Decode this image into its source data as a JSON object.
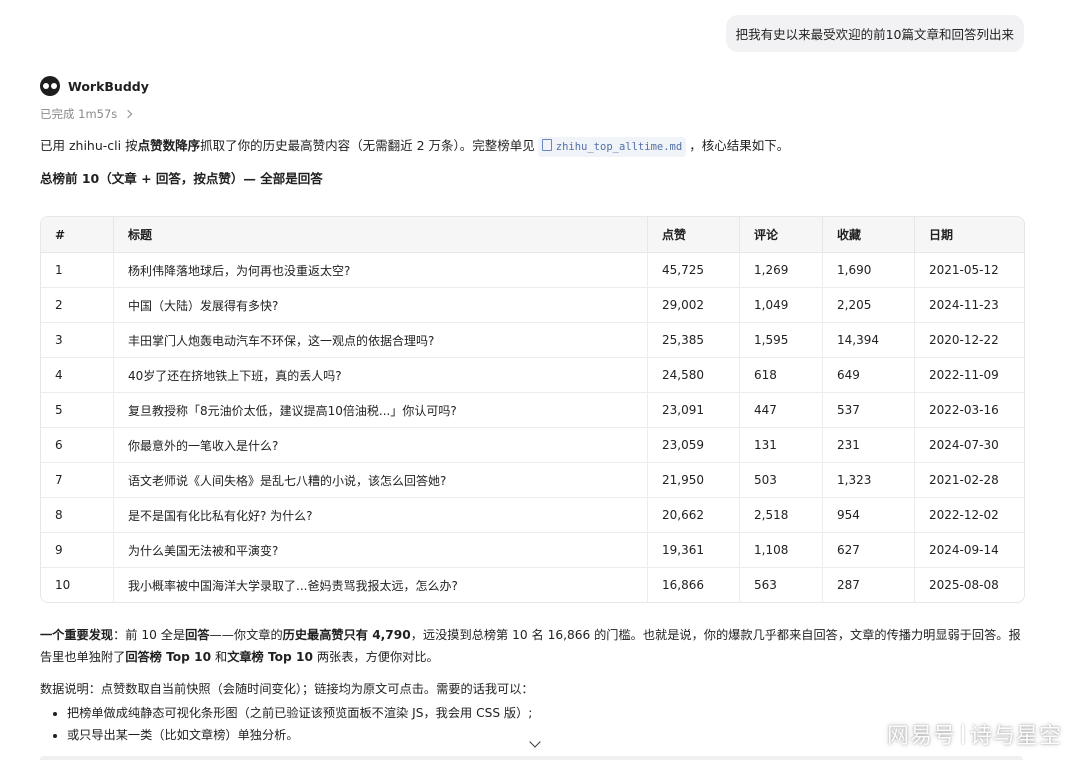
{
  "user_message": "把我有史以来最受欢迎的前10篇文章和回答列出来",
  "agent": {
    "name": "WorkBuddy",
    "status": "已完成 1m57s"
  },
  "intro": {
    "p1": "已用 zhihu-cli 按",
    "p1_bold": "点赞数降序",
    "p2": "抓取了你的历史最高赞内容（无需翻近 2 万条）。完整榜单见",
    "file_name": "zhihu_top_alltime.md",
    "p3": "，核心结果如下。"
  },
  "heading": "总榜前 10（文章 + 回答，按点赞）— 全部是回答",
  "table": {
    "headers": [
      "#",
      "标题",
      "点赞",
      "评论",
      "收藏",
      "日期"
    ],
    "rows": [
      [
        "1",
        "杨利伟降落地球后，为何再也没重返太空?",
        "45,725",
        "1,269",
        "1,690",
        "2021-05-12"
      ],
      [
        "2",
        "中国（大陆）发展得有多快?",
        "29,002",
        "1,049",
        "2,205",
        "2024-11-23"
      ],
      [
        "3",
        "丰田掌门人炮轰电动汽车不环保，这一观点的依据合理吗?",
        "25,385",
        "1,595",
        "14,394",
        "2020-12-22"
      ],
      [
        "4",
        "40岁了还在挤地铁上下班，真的丢人吗?",
        "24,580",
        "618",
        "649",
        "2022-11-09"
      ],
      [
        "5",
        "复旦教授称「8元油价太低，建议提高10倍油税...」你认可吗?",
        "23,091",
        "447",
        "537",
        "2022-03-16"
      ],
      [
        "6",
        "你最意外的一笔收入是什么?",
        "23,059",
        "131",
        "231",
        "2024-07-30"
      ],
      [
        "7",
        "语文老师说《人间失格》是乱七八糟的小说，该怎么回答她?",
        "21,950",
        "503",
        "1,323",
        "2021-02-28"
      ],
      [
        "8",
        "是不是国有化比私有化好? 为什么?",
        "20,662",
        "2,518",
        "954",
        "2022-12-02"
      ],
      [
        "9",
        "为什么美国无法被和平演变?",
        "19,361",
        "1,108",
        "627",
        "2024-09-14"
      ],
      [
        "10",
        "我小概率被中国海洋大学录取了...爸妈责骂我报太远，怎么办?",
        "16,866",
        "563",
        "287",
        "2025-08-08"
      ]
    ]
  },
  "finding": {
    "b1": "一个重要发现",
    "t1": "：前 10 全是",
    "b2": "回答",
    "t2": "——你文章的",
    "b3": "历史最高赞只有 4,790",
    "t3": "，远没摸到总榜第 10 名 16,866 的门槛。也就是说，你的爆款几乎都来自回答，文章的传播力明显弱于回答。报告里也单独附了",
    "b4": "回答榜 Top 10",
    "t4": " 和",
    "b5": "文章榜 Top 10",
    "t5": " 两张表，方便你对比。"
  },
  "notes": {
    "intro": "数据说明：点赞数取自当前快照（会随时间变化）；链接均为原文可点击。需要的话我可以：",
    "items": [
      "把榜单做成纯静态可视化条形图（之前已验证该预览面板不渲染 JS，我会用 CSS 版）;",
      "或只导出某一类（比如文章榜）单独分析。"
    ]
  },
  "watermark": {
    "left": "网易号",
    "right": "诗与星空"
  }
}
